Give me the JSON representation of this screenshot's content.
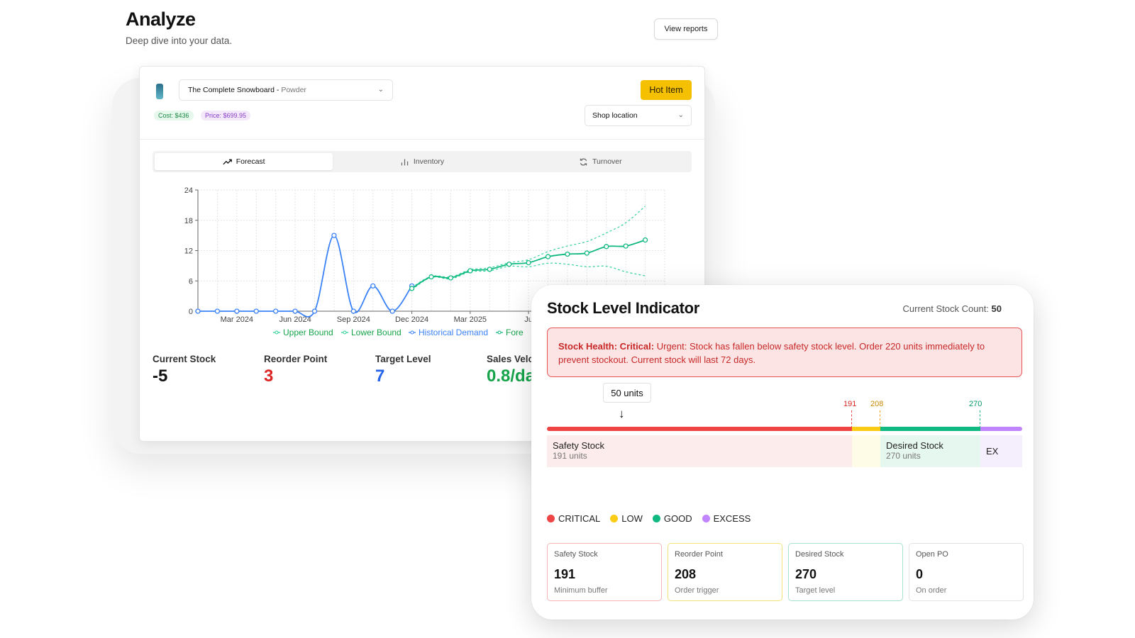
{
  "page": {
    "title": "Analyze",
    "subtitle": "Deep dive into your data.",
    "view_reports_label": "View reports"
  },
  "product": {
    "name": "The Complete Snowboard - ",
    "variant": "Powder",
    "cost": "Cost: $436",
    "price": "Price: $699.95",
    "badge": "Hot Item",
    "location_label": "Shop location"
  },
  "tabs": [
    {
      "label": "Forecast",
      "icon": "trend-up-icon",
      "active": true
    },
    {
      "label": "Inventory",
      "icon": "bar-chart-icon",
      "active": false
    },
    {
      "label": "Turnover",
      "icon": "refresh-icon",
      "active": false
    }
  ],
  "chart_data": {
    "type": "line",
    "title": "",
    "xlabel": "",
    "ylabel": "",
    "ylim": [
      0,
      24
    ],
    "y_ticks": [
      "0",
      "6",
      "12",
      "18",
      "24"
    ],
    "x_ticks": [
      "Mar 2024",
      "Jun 2024",
      "Sep 2024",
      "Dec 2024",
      "Mar 2025",
      "Ju"
    ],
    "grid": true,
    "legend": "bottom",
    "legend_labels": [
      "Upper Bound",
      "Lower Bound",
      "Historical Demand",
      "Fore"
    ],
    "colors": {
      "historical": "#3b82f6",
      "forecast": "#10b981",
      "bounds": "#34d399"
    },
    "series": [
      {
        "name": "Historical Demand",
        "x": [
          0,
          1,
          2,
          3,
          4,
          5,
          6,
          7,
          8,
          9,
          10,
          11
        ],
        "values": [
          0,
          0,
          0,
          0,
          0,
          0,
          0,
          15,
          0,
          5,
          0,
          5
        ]
      },
      {
        "name": "Fore",
        "x": [
          11,
          12,
          13,
          14,
          15,
          16,
          17,
          18,
          19,
          20,
          21,
          22,
          23
        ],
        "values": [
          4.5,
          6.8,
          6.6,
          8,
          8.3,
          9.3,
          9.6,
          10.8,
          11.3,
          11.5,
          12.8,
          12.9,
          14.1
        ]
      },
      {
        "name": "Upper Bound",
        "x": [
          11,
          12,
          13,
          14,
          15,
          16,
          17,
          18,
          19,
          20,
          21,
          22,
          23
        ],
        "values": [
          4.7,
          6.9,
          6.8,
          8.2,
          8.6,
          9.6,
          10.2,
          11.8,
          12.9,
          13.8,
          15.5,
          17.5,
          20.8
        ]
      },
      {
        "name": "Lower Bound",
        "x": [
          11,
          12,
          13,
          14,
          15,
          16,
          17,
          18,
          19,
          20,
          21,
          22,
          23
        ],
        "values": [
          4.3,
          6.7,
          6.4,
          7.8,
          8.0,
          8.9,
          8.8,
          9.5,
          9.3,
          8.8,
          8.9,
          7.8,
          7.0
        ]
      }
    ]
  },
  "stats": [
    {
      "label": "Current Stock",
      "value": "-5",
      "color": "#111111"
    },
    {
      "label": "Reorder Point",
      "value": "3",
      "color": "#dc2626"
    },
    {
      "label": "Target Level",
      "value": "7",
      "color": "#2563eb"
    },
    {
      "label": "Sales Velo",
      "value": "0.8/da",
      "color": "#16a34a"
    }
  ],
  "stock": {
    "title": "Stock Level Indicator",
    "count_label": "Current Stock Count: ",
    "count_value": "50",
    "alert_title": "Stock Health: Critical:",
    "alert_text": " Urgent: Stock has fallen below safety stock level. Order 220 units immediately to prevent stockout. Current stock will last 72 days.",
    "current_units_label": "50 units",
    "markers": [
      "191",
      "208",
      "270"
    ],
    "zones": {
      "safety_label": "Safety Stock",
      "safety_sub": "191 units",
      "desired_label": "Desired Stock",
      "desired_sub": "270 units",
      "excess_label": "EX"
    },
    "legend": [
      {
        "label": "CRITICAL",
        "color": "#ef4444"
      },
      {
        "label": "LOW",
        "color": "#facc15"
      },
      {
        "label": "GOOD",
        "color": "#10b981"
      },
      {
        "label": "EXCESS",
        "color": "#c084fc"
      }
    ],
    "metrics": [
      {
        "label": "Safety Stock",
        "value": "191",
        "sub": "Minimum buffer",
        "color": "#f5b5b5"
      },
      {
        "label": "Reorder Point",
        "value": "208",
        "sub": "Order trigger",
        "color": "#f4e27a"
      },
      {
        "label": "Desired Stock",
        "value": "270",
        "sub": "Target level",
        "color": "#a7e3cb"
      },
      {
        "label": "Open PO",
        "value": "0",
        "sub": "On order",
        "color": "#e3e3e3"
      }
    ]
  }
}
